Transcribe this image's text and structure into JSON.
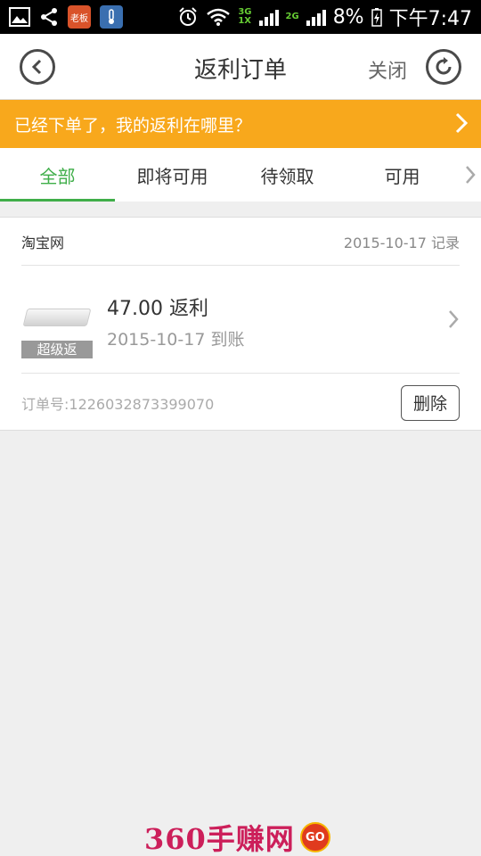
{
  "statusbar": {
    "app_badge_news": "老板",
    "network_primary": "3G",
    "network_secondary": "1X",
    "network_third": "2G",
    "battery": "8%",
    "time": "下午7:47",
    "icons": [
      "image-icon",
      "share-icon",
      "news-app-icon",
      "thermometer-app-icon",
      "alarm-icon",
      "wifi-icon",
      "signal-icon",
      "battery-charging-icon"
    ]
  },
  "header": {
    "title": "返利订单",
    "close_label": "关闭",
    "back_icon": "back-circle-icon",
    "refresh_icon": "refresh-circle-icon"
  },
  "banner": {
    "text": "已经下单了，我的返利在哪里？",
    "color": "#f8a81c"
  },
  "tabs": [
    {
      "label": "全部",
      "active": true
    },
    {
      "label": "即将可用",
      "active": false
    },
    {
      "label": "待领取",
      "active": false
    },
    {
      "label": "可用",
      "active": false
    }
  ],
  "accent_color": "#3fae49",
  "order": {
    "store": "淘宝网",
    "record_date": "2015-10-17 记录",
    "product_tag": "超级返",
    "amount": "47.00 返利",
    "arrive_date": "2015-10-17 到账",
    "order_number": "订单号:1226032873399070",
    "delete_label": "删除"
  },
  "watermark": {
    "text": "360手赚网",
    "badge": "GO"
  }
}
